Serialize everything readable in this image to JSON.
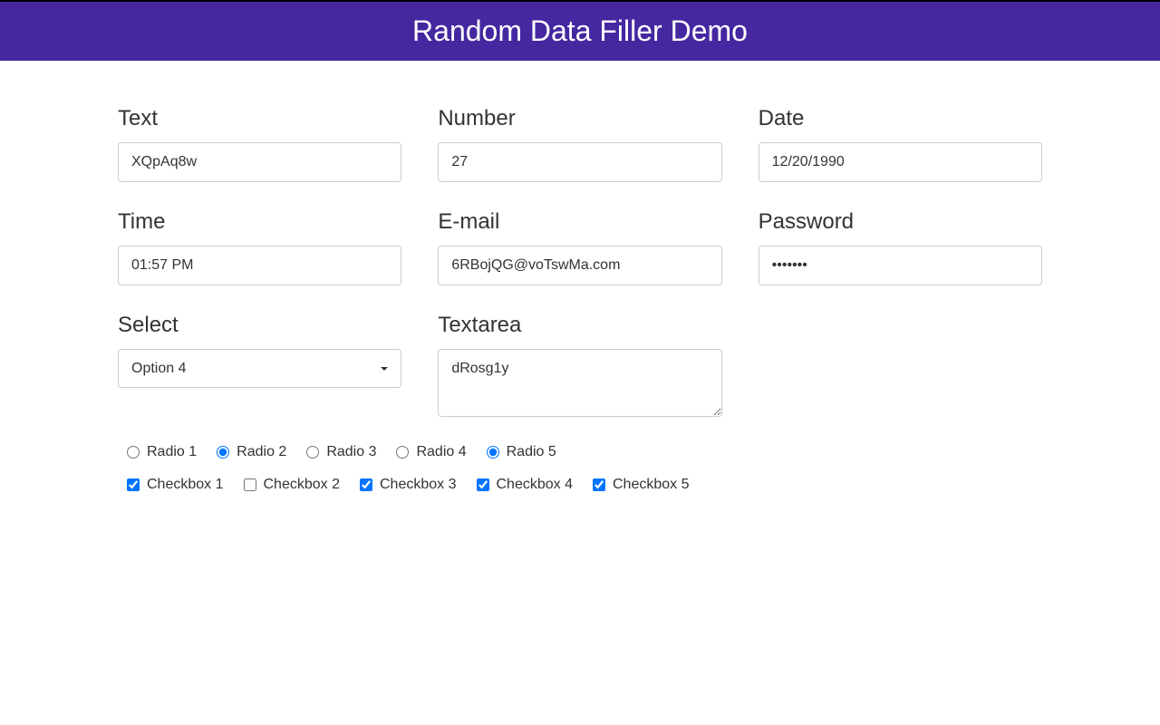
{
  "header": {
    "title": "Random Data Filler Demo"
  },
  "fields": {
    "text": {
      "label": "Text",
      "value": "XQpAq8w"
    },
    "number": {
      "label": "Number",
      "value": "27"
    },
    "date": {
      "label": "Date",
      "value": "12/20/1990"
    },
    "time": {
      "label": "Time",
      "value": "01:57 PM"
    },
    "email": {
      "label": "E-mail",
      "value": "6RBojQG@voTswMa.com"
    },
    "password": {
      "label": "Password",
      "value": "•••••••"
    },
    "select": {
      "label": "Select",
      "value": "Option 4"
    },
    "textarea": {
      "label": "Textarea",
      "value": "dRosg1y"
    }
  },
  "radios": [
    {
      "label": "Radio 1",
      "checked": false
    },
    {
      "label": "Radio 2",
      "checked": true
    },
    {
      "label": "Radio 3",
      "checked": false
    },
    {
      "label": "Radio 4",
      "checked": false
    },
    {
      "label": "Radio 5",
      "checked": true
    }
  ],
  "checkboxes": [
    {
      "label": "Checkbox 1",
      "checked": true
    },
    {
      "label": "Checkbox 2",
      "checked": false
    },
    {
      "label": "Checkbox 3",
      "checked": true
    },
    {
      "label": "Checkbox 4",
      "checked": true
    },
    {
      "label": "Checkbox 5",
      "checked": true
    }
  ]
}
